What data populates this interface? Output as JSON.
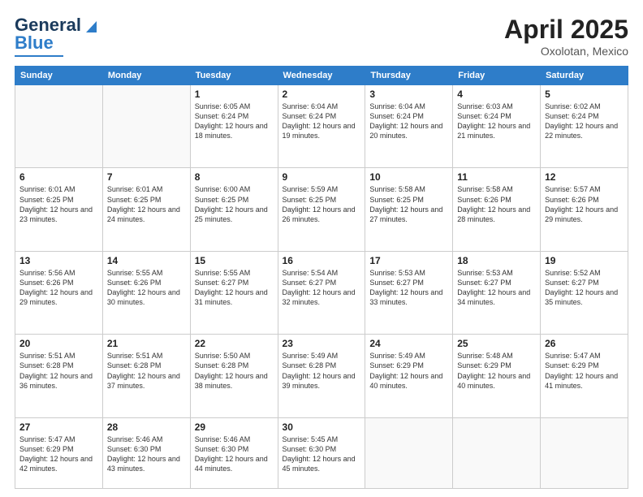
{
  "header": {
    "logo_line1": "General",
    "logo_line2": "Blue",
    "title": "April 2025",
    "subtitle": "Oxolotan, Mexico"
  },
  "days_of_week": [
    "Sunday",
    "Monday",
    "Tuesday",
    "Wednesday",
    "Thursday",
    "Friday",
    "Saturday"
  ],
  "weeks": [
    [
      {
        "day": "",
        "info": ""
      },
      {
        "day": "",
        "info": ""
      },
      {
        "day": "1",
        "info": "Sunrise: 6:05 AM\nSunset: 6:24 PM\nDaylight: 12 hours\nand 18 minutes."
      },
      {
        "day": "2",
        "info": "Sunrise: 6:04 AM\nSunset: 6:24 PM\nDaylight: 12 hours\nand 19 minutes."
      },
      {
        "day": "3",
        "info": "Sunrise: 6:04 AM\nSunset: 6:24 PM\nDaylight: 12 hours\nand 20 minutes."
      },
      {
        "day": "4",
        "info": "Sunrise: 6:03 AM\nSunset: 6:24 PM\nDaylight: 12 hours\nand 21 minutes."
      },
      {
        "day": "5",
        "info": "Sunrise: 6:02 AM\nSunset: 6:24 PM\nDaylight: 12 hours\nand 22 minutes."
      }
    ],
    [
      {
        "day": "6",
        "info": "Sunrise: 6:01 AM\nSunset: 6:25 PM\nDaylight: 12 hours\nand 23 minutes."
      },
      {
        "day": "7",
        "info": "Sunrise: 6:01 AM\nSunset: 6:25 PM\nDaylight: 12 hours\nand 24 minutes."
      },
      {
        "day": "8",
        "info": "Sunrise: 6:00 AM\nSunset: 6:25 PM\nDaylight: 12 hours\nand 25 minutes."
      },
      {
        "day": "9",
        "info": "Sunrise: 5:59 AM\nSunset: 6:25 PM\nDaylight: 12 hours\nand 26 minutes."
      },
      {
        "day": "10",
        "info": "Sunrise: 5:58 AM\nSunset: 6:25 PM\nDaylight: 12 hours\nand 27 minutes."
      },
      {
        "day": "11",
        "info": "Sunrise: 5:58 AM\nSunset: 6:26 PM\nDaylight: 12 hours\nand 28 minutes."
      },
      {
        "day": "12",
        "info": "Sunrise: 5:57 AM\nSunset: 6:26 PM\nDaylight: 12 hours\nand 29 minutes."
      }
    ],
    [
      {
        "day": "13",
        "info": "Sunrise: 5:56 AM\nSunset: 6:26 PM\nDaylight: 12 hours\nand 29 minutes."
      },
      {
        "day": "14",
        "info": "Sunrise: 5:55 AM\nSunset: 6:26 PM\nDaylight: 12 hours\nand 30 minutes."
      },
      {
        "day": "15",
        "info": "Sunrise: 5:55 AM\nSunset: 6:27 PM\nDaylight: 12 hours\nand 31 minutes."
      },
      {
        "day": "16",
        "info": "Sunrise: 5:54 AM\nSunset: 6:27 PM\nDaylight: 12 hours\nand 32 minutes."
      },
      {
        "day": "17",
        "info": "Sunrise: 5:53 AM\nSunset: 6:27 PM\nDaylight: 12 hours\nand 33 minutes."
      },
      {
        "day": "18",
        "info": "Sunrise: 5:53 AM\nSunset: 6:27 PM\nDaylight: 12 hours\nand 34 minutes."
      },
      {
        "day": "19",
        "info": "Sunrise: 5:52 AM\nSunset: 6:27 PM\nDaylight: 12 hours\nand 35 minutes."
      }
    ],
    [
      {
        "day": "20",
        "info": "Sunrise: 5:51 AM\nSunset: 6:28 PM\nDaylight: 12 hours\nand 36 minutes."
      },
      {
        "day": "21",
        "info": "Sunrise: 5:51 AM\nSunset: 6:28 PM\nDaylight: 12 hours\nand 37 minutes."
      },
      {
        "day": "22",
        "info": "Sunrise: 5:50 AM\nSunset: 6:28 PM\nDaylight: 12 hours\nand 38 minutes."
      },
      {
        "day": "23",
        "info": "Sunrise: 5:49 AM\nSunset: 6:28 PM\nDaylight: 12 hours\nand 39 minutes."
      },
      {
        "day": "24",
        "info": "Sunrise: 5:49 AM\nSunset: 6:29 PM\nDaylight: 12 hours\nand 40 minutes."
      },
      {
        "day": "25",
        "info": "Sunrise: 5:48 AM\nSunset: 6:29 PM\nDaylight: 12 hours\nand 40 minutes."
      },
      {
        "day": "26",
        "info": "Sunrise: 5:47 AM\nSunset: 6:29 PM\nDaylight: 12 hours\nand 41 minutes."
      }
    ],
    [
      {
        "day": "27",
        "info": "Sunrise: 5:47 AM\nSunset: 6:29 PM\nDaylight: 12 hours\nand 42 minutes."
      },
      {
        "day": "28",
        "info": "Sunrise: 5:46 AM\nSunset: 6:30 PM\nDaylight: 12 hours\nand 43 minutes."
      },
      {
        "day": "29",
        "info": "Sunrise: 5:46 AM\nSunset: 6:30 PM\nDaylight: 12 hours\nand 44 minutes."
      },
      {
        "day": "30",
        "info": "Sunrise: 5:45 AM\nSunset: 6:30 PM\nDaylight: 12 hours\nand 45 minutes."
      },
      {
        "day": "",
        "info": ""
      },
      {
        "day": "",
        "info": ""
      },
      {
        "day": "",
        "info": ""
      }
    ]
  ]
}
